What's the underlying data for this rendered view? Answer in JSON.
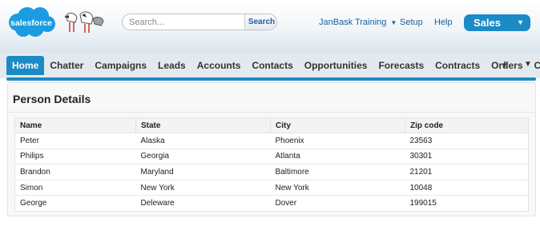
{
  "header": {
    "logo_text": "salesforce",
    "search": {
      "placeholder": "Search...",
      "button_label": "Search"
    },
    "user_menu_label": "JanBask Training",
    "links": [
      "Setup",
      "Help"
    ],
    "app_menu_label": "Sales"
  },
  "tabs": [
    "Home",
    "Chatter",
    "Campaigns",
    "Leads",
    "Accounts",
    "Contacts",
    "Opportunities",
    "Forecasts",
    "Contracts",
    "Orders",
    "Cases"
  ],
  "active_tab": "Home",
  "panel": {
    "title": "Person Details",
    "columns": [
      "Name",
      "State",
      "City",
      "Zip code"
    ],
    "rows": [
      [
        "Peter",
        "Alaska",
        "Phoenix",
        "23563"
      ],
      [
        "Philips",
        "Georgia",
        "Atlanta",
        "30301"
      ],
      [
        "Brandon",
        "Maryland",
        "Baltimore",
        "21201"
      ],
      [
        "Simon",
        "New York",
        "New York",
        "10048"
      ],
      [
        "George",
        "Deleware",
        "Dover",
        "199015"
      ]
    ]
  },
  "colors": {
    "accent": "#1b8bc6",
    "link": "#1b5f9d",
    "logo_blue": "#1b9ce0"
  },
  "icons": {
    "add_tab": "plus-icon",
    "more_tabs": "chevron-down-icon"
  }
}
